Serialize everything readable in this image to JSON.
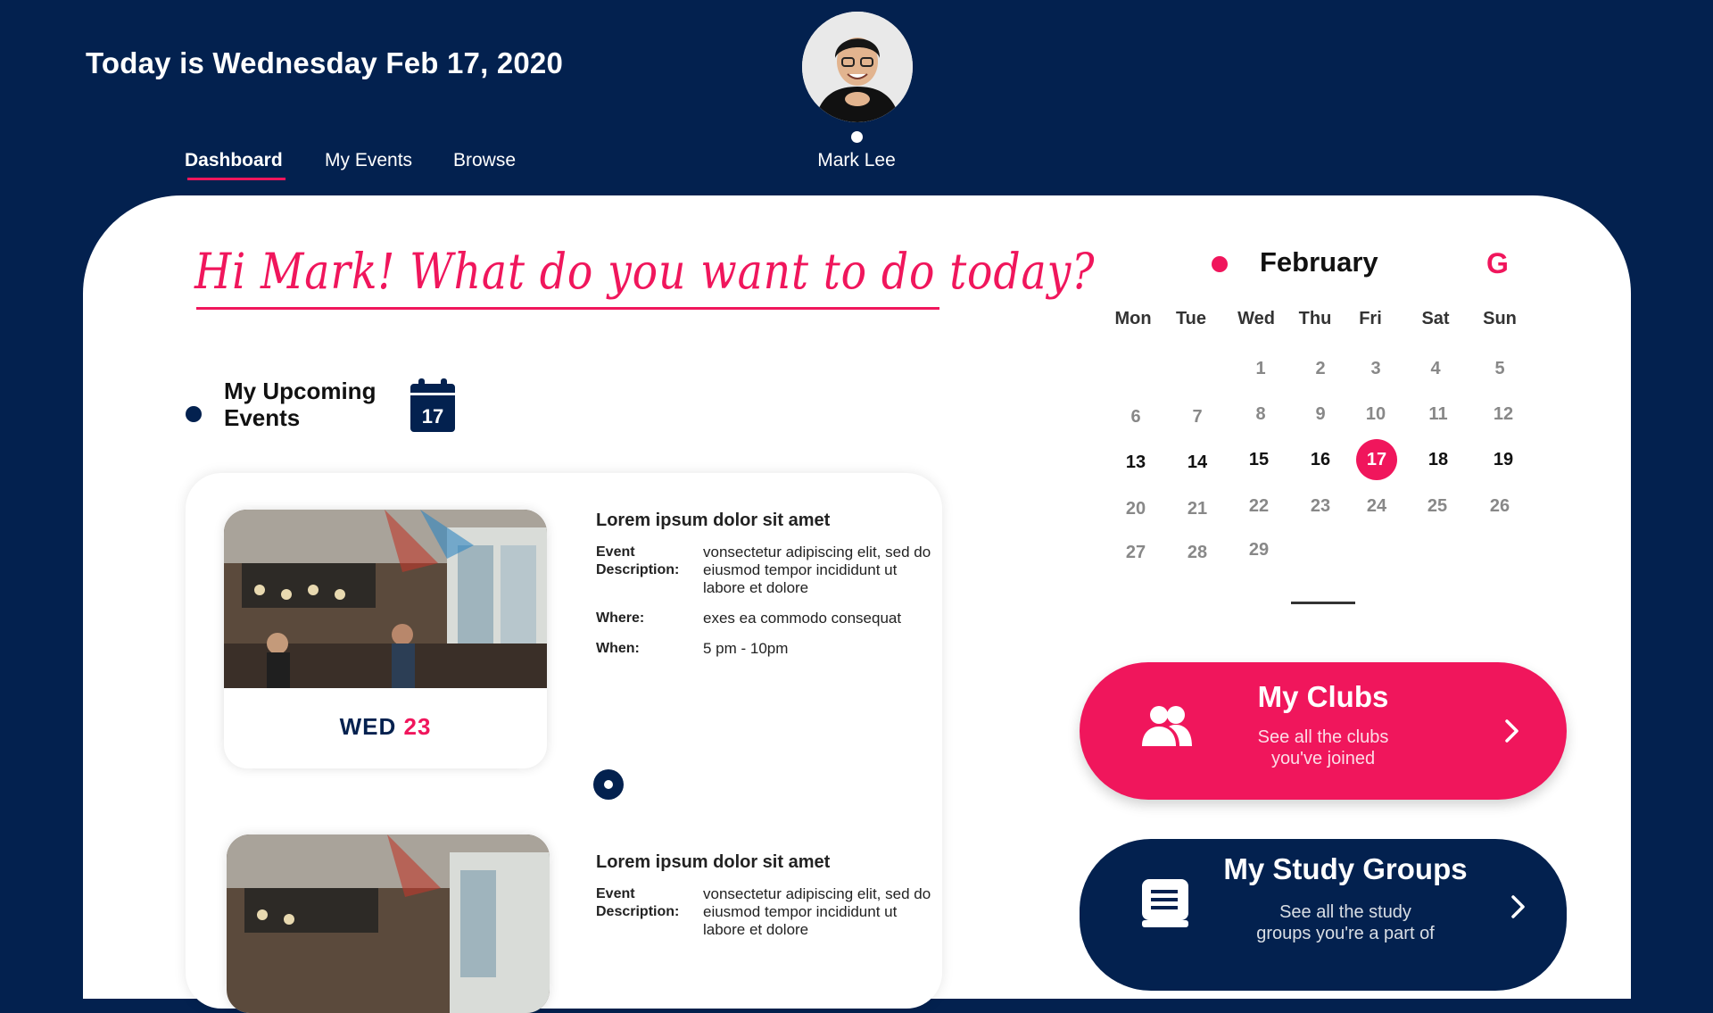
{
  "header": {
    "date_title": "Today is Wednesday Feb 17, 2020",
    "user_name": "Mark Lee"
  },
  "nav": {
    "tabs": [
      {
        "label": "Dashboard",
        "active": true
      },
      {
        "label": "My Events",
        "active": false
      },
      {
        "label": "Browse",
        "active": false
      }
    ]
  },
  "greeting": "Hi Mark! What do you want to do today?",
  "upcoming": {
    "title": "My Upcoming Events",
    "calendar_icon_day": "17"
  },
  "events": [
    {
      "title": "Lorem ipsum dolor sit amet",
      "desc_label": "Event Description:",
      "description": "vonsectetur adipiscing elit, sed do eiusmod tempor incididunt ut labore et dolore",
      "where_label": "Where:",
      "where": "exes ea commodo consequat",
      "when_label": "When:",
      "when": "5 pm - 10pm",
      "day_name": "WED",
      "day_num": "23"
    },
    {
      "title": "Lorem ipsum dolor sit amet",
      "desc_label": "Event Description:",
      "description": "vonsectetur adipiscing elit, sed do eiusmod tempor incididunt ut labore et dolore"
    }
  ],
  "calendar": {
    "month": "February",
    "google_icon": "G",
    "weekdays": [
      "Mon",
      "Tue",
      "Wed",
      "Thu",
      "Fri",
      "Sat",
      "Sun"
    ],
    "today": "17"
  },
  "clubs": {
    "title": "My Clubs",
    "subtitle_1": "See all the clubs",
    "subtitle_2": "you've joined"
  },
  "study_groups": {
    "title": "My Study Groups",
    "subtitle_1": "See all the study",
    "subtitle_2": "groups you're a part of"
  },
  "colors": {
    "navy": "#03214f",
    "accent": "#f0165c",
    "panel": "#ffffff"
  },
  "icons": [
    "user-avatar",
    "calendar-icon",
    "google-icon",
    "people-icon",
    "book-icon",
    "chevron-right-icon"
  ]
}
